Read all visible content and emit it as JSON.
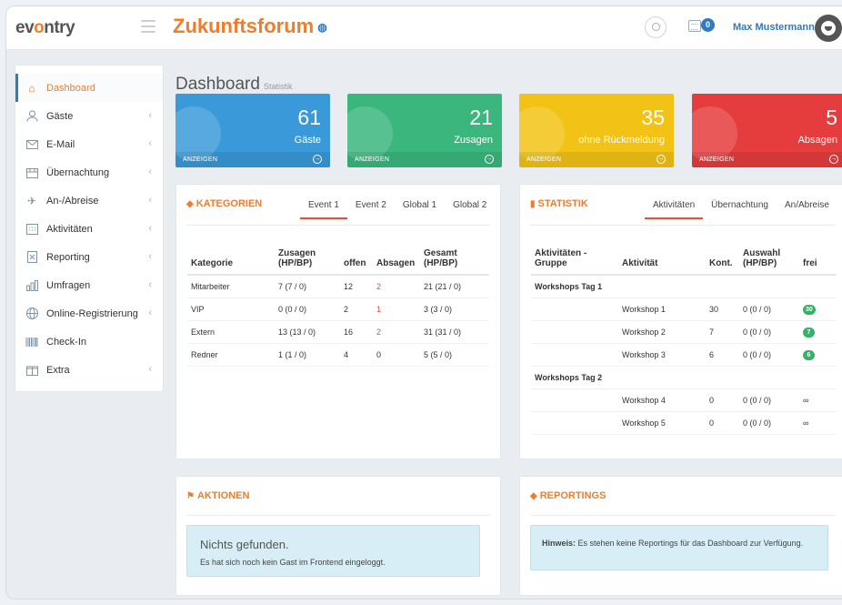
{
  "header": {
    "logo_prefix": "ev",
    "logo_o": "o",
    "logo_suffix": "ntry",
    "title": "Zukunftsforum",
    "title_icon": "globe-icon",
    "notification_count": "0",
    "user_name": "Max Mustermann"
  },
  "sidebar": {
    "items": [
      {
        "label": "Dashboard",
        "icon": "home-icon"
      },
      {
        "label": "Gäste",
        "icon": "user-icon"
      },
      {
        "label": "E-Mail",
        "icon": "mail-icon"
      },
      {
        "label": "Übernachtung",
        "icon": "bed-icon"
      },
      {
        "label": "An-/Abreise",
        "icon": "plane-icon"
      },
      {
        "label": "Aktivitäten",
        "icon": "calendar-icon"
      },
      {
        "label": "Reporting",
        "icon": "file-icon"
      },
      {
        "label": "Umfragen",
        "icon": "bar-chart-icon"
      },
      {
        "label": "Online-Registrierung",
        "icon": "globe-icon"
      },
      {
        "label": "Check-In",
        "icon": "barcode-icon"
      },
      {
        "label": "Extra",
        "icon": "gift-icon"
      }
    ],
    "chevron": "‹"
  },
  "page": {
    "title": "Dashboard",
    "subtitle": "Statistik"
  },
  "stats": [
    {
      "value": "61",
      "label": "Gäste",
      "link": "ANZEIGEN",
      "color": "#3a9ad9"
    },
    {
      "value": "21",
      "label": "Zusagen",
      "link": "ANZEIGEN",
      "color": "#3bb77e"
    },
    {
      "value": "35",
      "label": "ohne Rückmeldung",
      "link": "ANZEIGEN",
      "color": "#f2c316"
    },
    {
      "value": "5",
      "label": "Absagen",
      "link": "ANZEIGEN",
      "color": "#e53d3d"
    }
  ],
  "kategorien": {
    "title": "KATEGORIEN",
    "tabs": [
      "Event 1",
      "Event 2",
      "Global 1",
      "Global 2"
    ],
    "columns": [
      "Kategorie",
      "Zusagen (HP/BP)",
      "offen",
      "Absagen",
      "Gesamt (HP/BP)"
    ],
    "rows": [
      [
        "Mitarbeiter",
        "7 (7 / 0)",
        "12",
        "2",
        "21 (21 / 0)"
      ],
      [
        "VIP",
        "0 (0 / 0)",
        "2",
        "1",
        "3 (3 / 0)"
      ],
      [
        "Extern",
        "13 (13 / 0)",
        "16",
        "2",
        "31 (31 / 0)"
      ],
      [
        "Redner",
        "1 (1 / 0)",
        "4",
        "0",
        "5 (5 / 0)"
      ]
    ]
  },
  "statistik": {
    "title": "STATISTIK",
    "tabs": [
      "Aktivitäten",
      "Übernachtung",
      "An/Abreise"
    ],
    "columns": [
      "Aktivitäten - Gruppe",
      "Aktivität",
      "Kont.",
      "Auswahl (HP/BP)",
      "frei"
    ],
    "groups": [
      {
        "name": "Workshops Tag 1",
        "rows": [
          [
            "Workshop 1",
            "30",
            "0 (0 / 0)",
            "30"
          ],
          [
            "Workshop 2",
            "7",
            "0 (0 / 0)",
            "7"
          ],
          [
            "Workshop 3",
            "6",
            "0 (0 / 0)",
            "6"
          ]
        ]
      },
      {
        "name": "Workshops Tag 2",
        "rows": [
          [
            "Workshop 4",
            "0",
            "0 (0 / 0)",
            "∞"
          ],
          [
            "Workshop 5",
            "0",
            "0 (0 / 0)",
            "∞"
          ]
        ]
      }
    ]
  },
  "aktionen": {
    "title": "AKTIONEN",
    "empty_title": "Nichts gefunden.",
    "empty_text": "Es hat sich noch kein Gast im Frontend eingeloggt."
  },
  "reportings": {
    "title": "REPORTINGS",
    "hint_label": "Hinweis:",
    "hint_text": " Es stehen keine Reportings für das Dashboard zur Verfügung."
  }
}
